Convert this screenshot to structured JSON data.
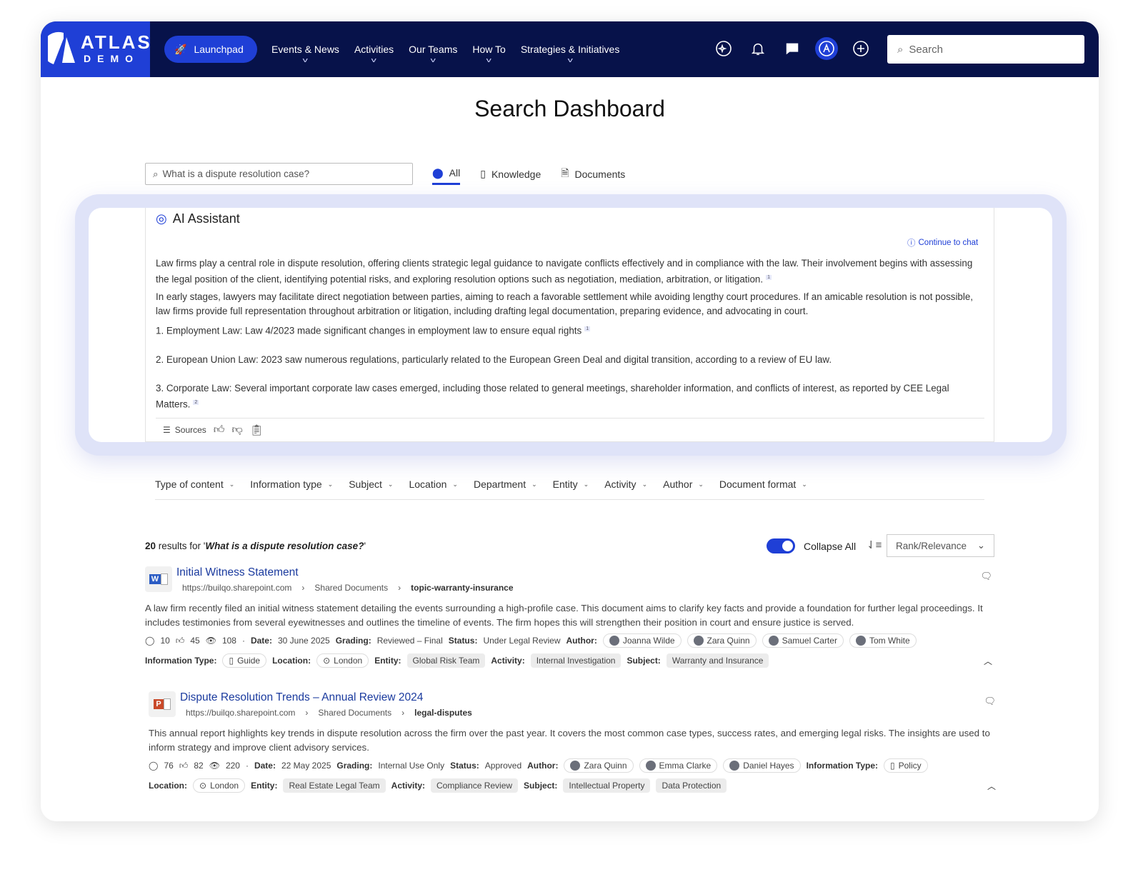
{
  "nav": {
    "logo_top": "ATLAS",
    "logo_bottom": "DEMO",
    "launchpad": "Launchpad",
    "menu": [
      "Events & News",
      "Activities",
      "Our Teams",
      "How To",
      "Strategies & Initiatives"
    ],
    "search_placeholder": "Search"
  },
  "page_title": "Search Dashboard",
  "search": {
    "value": "What is a dispute resolution case?"
  },
  "tabs": [
    "All",
    "Knowledge",
    "Documents"
  ],
  "ai": {
    "title": "AI Assistant",
    "continue": "Continue to chat",
    "p1": "Law firms play a central role in dispute resolution, offering clients strategic legal guidance to navigate conflicts effectively and in compliance with the law. Their involvement begins with assessing the legal position of the client, identifying potential risks, and exploring resolution options such as negotiation, mediation, arbitration, or litigation.",
    "p2": "In early stages, lawyers may facilitate direct negotiation between parties, aiming to reach a favorable settlement while avoiding lengthy court procedures. If an amicable resolution is not possible, law firms provide full representation throughout arbitration or litigation, including drafting legal documentation, preparing evidence, and advocating in court.",
    "l1": "1. Employment Law: Law 4/2023 made significant changes in employment law to ensure equal rights",
    "l2": "2. European Union Law: 2023 saw numerous regulations, particularly related to the European Green Deal and digital transition, according to a review of EU law.",
    "l3": "3. Corporate Law: Several important corporate law cases emerged, including those related to general meetings, shareholder information, and conflicts of interest, as reported by CEE Legal Matters.",
    "refs": [
      "1",
      "1",
      "2"
    ],
    "sources": "Sources"
  },
  "filters": [
    "Type of content",
    "Information type",
    "Subject",
    "Location",
    "Department",
    "Entity",
    "Activity",
    "Author",
    "Document format"
  ],
  "results_header": {
    "count": "20",
    "text": " results for '",
    "query": "What is a dispute resolution case?",
    "end": "'"
  },
  "collapse_all": "Collapse All",
  "sort": "Rank/Relevance",
  "labels": {
    "date": "Date:",
    "grading": "Grading:",
    "status": "Status:",
    "author": "Author:",
    "info": "Information Type:",
    "location": "Location:",
    "entity": "Entity:",
    "activity": "Activity:",
    "subject": "Subject:"
  },
  "results": [
    {
      "title": "Initial Witness Statement",
      "url": [
        "https://builqo.sharepoint.com",
        "Shared Documents",
        "topic-warranty-insurance"
      ],
      "desc": "A law firm recently filed an initial witness statement detailing the events surrounding a high-profile case. This document aims to clarify key facts and provide a foundation for further legal proceedings. It includes testimonies from several eyewitnesses and outlines the timeline of events. The firm hopes this will strengthen their position in court and ensure justice is served.",
      "comments": "10",
      "likes": "45",
      "views": "108",
      "date": "30 June 2025",
      "grading": "Reviewed – Final",
      "status": "Under Legal Review",
      "authors": [
        "Joanna Wilde",
        "Zara Quinn",
        "Samuel Carter",
        "Tom White"
      ],
      "info": "Guide",
      "location": "London",
      "entity": "Global Risk Team",
      "activity": "Internal Investigation",
      "subjects": [
        "Warranty and Insurance"
      ],
      "filetype": "W",
      "color": "#2b5cc4"
    },
    {
      "title": "Dispute Resolution Trends – Annual Review 2024",
      "url": [
        "https://builqo.sharepoint.com",
        "Shared Documents",
        "legal-disputes"
      ],
      "desc": "This annual report highlights key trends in dispute resolution across the firm over the past year. It covers the most common case types, success rates, and emerging legal risks. The insights are used to inform strategy and improve client advisory services.",
      "comments": "76",
      "likes": "82",
      "views": "220",
      "date": "22 May 2025",
      "grading": "Internal Use Only",
      "status": "Approved",
      "authors": [
        "Zara Quinn",
        "Emma Clarke",
        "Daniel Hayes"
      ],
      "info": "Policy",
      "location": "London",
      "entity": "Real Estate Legal Team",
      "activity": "Compliance Review",
      "subjects": [
        "Intellectual Property",
        "Data Protection"
      ],
      "filetype": "P",
      "color": "#c94a2a"
    }
  ]
}
